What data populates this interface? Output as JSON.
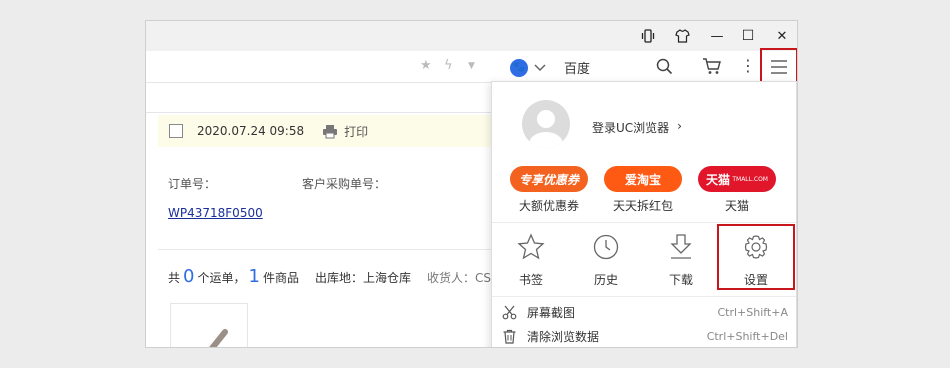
{
  "window": {
    "controls": {
      "phone_icon": "phone-icon",
      "skin_icon": "shirt-icon",
      "minimize": "—",
      "maximize": "☐",
      "close": "✕"
    }
  },
  "toolbar": {
    "search_engine": "百度"
  },
  "page": {
    "order_date": "2020.07.24 09:58",
    "print_label": "打印",
    "order_no_label": "订单号：",
    "customer_po_label": "客户采购单号：",
    "order_link": "WP43718F0500",
    "summary": {
      "prefix": "共",
      "waybill_count": "0",
      "waybill_label": "个运单，",
      "item_count": "1",
      "item_label": "件商品",
      "warehouse": "出库地：上海仓库",
      "receiver": "收货人：CS"
    }
  },
  "menu": {
    "login_text": "登录UC浏览器",
    "login_arrow": "›",
    "promos": [
      {
        "pill": "专享优惠券",
        "caption": "大额优惠券",
        "color": "#f4621f"
      },
      {
        "pill": "爱淘宝",
        "caption": "天天拆红包",
        "color": "#ff5a14"
      },
      {
        "pill": "天猫",
        "caption": "天猫",
        "color": "#e1162b",
        "tag": "TMALL.COM"
      }
    ],
    "grid": [
      {
        "label": "书签",
        "icon": "star-outline-icon"
      },
      {
        "label": "历史",
        "icon": "clock-icon"
      },
      {
        "label": "下载",
        "icon": "download-icon"
      },
      {
        "label": "设置",
        "icon": "gear-icon"
      }
    ],
    "items": [
      {
        "label": "屏幕截图",
        "shortcut": "Ctrl+Shift+A",
        "icon": "scissors-icon"
      },
      {
        "label": "清除浏览数据",
        "shortcut": "Ctrl+Shift+Del",
        "icon": "trash-icon"
      }
    ]
  }
}
